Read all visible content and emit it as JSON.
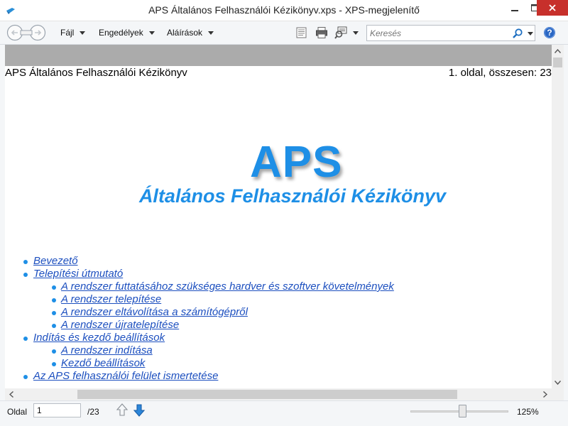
{
  "window": {
    "title": "APS Általános Felhasználói Kézikönyv.xps - XPS-megjelenítő"
  },
  "toolbar": {
    "menus": [
      "Fájl",
      "Engedélyek",
      "Aláírások"
    ],
    "search_placeholder": "Keresés",
    "icons": [
      "back-forward-icon",
      "reading-view-icon",
      "print-icon",
      "zoom-icon",
      "search-icon",
      "help-icon"
    ]
  },
  "document": {
    "header_title": "APS Általános Felhasználói Kézikönyv",
    "header_page": "1. oldal, összesen: 23",
    "logo_text": "APS",
    "subtitle": "Általános Felhasználói Kézikönyv",
    "toc": [
      {
        "level": 1,
        "text": "Bevezető"
      },
      {
        "level": 1,
        "text": "Telepítési útmutató"
      },
      {
        "level": 2,
        "text": "A rendszer futtatásához szükséges hardver és szoftver követelmények"
      },
      {
        "level": 2,
        "text": "A rendszer telepítése"
      },
      {
        "level": 2,
        "text": "A rendszer eltávolítása a számítógépről"
      },
      {
        "level": 2,
        "text": "A rendszer újratelepítése"
      },
      {
        "level": 1,
        "text": "Indítás és kezdő beállítások"
      },
      {
        "level": 2,
        "text": "A rendszer indítása"
      },
      {
        "level": 2,
        "text": "Kezdő beállítások"
      },
      {
        "level": 1,
        "text": "Az APS felhasználói felület ismertetése"
      }
    ]
  },
  "statusbar": {
    "page_label": "Oldal",
    "current_page": "1",
    "total_pages": "/23",
    "zoom_level": "125%"
  },
  "colors": {
    "accent": "#1e8fe6",
    "link": "#1c4fbf",
    "close_button": "#c7302b"
  }
}
